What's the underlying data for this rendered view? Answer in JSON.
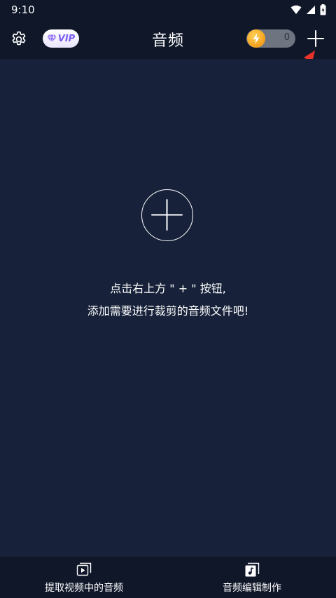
{
  "status_bar": {
    "time": "9:10",
    "icons": [
      "wifi-icon",
      "signal-icon",
      "battery-icon"
    ]
  },
  "header": {
    "title": "音频",
    "vip_label": "VIP",
    "energy_count": "0",
    "icons": [
      "gear-icon",
      "diamond-icon",
      "lightning-coin-icon",
      "plus-icon"
    ]
  },
  "main": {
    "hint_line_1": "点击右上方 \" + \" 按钮,",
    "hint_line_2": "添加需要进行裁剪的音频文件吧!"
  },
  "bottom_tabs": [
    {
      "label": "提取视频中的音频",
      "icon": "video-play-icon"
    },
    {
      "label": "音频编辑制作",
      "icon": "music-note-icon"
    }
  ],
  "colors": {
    "background": "#17223a",
    "header_background": "#0f1729",
    "annotation_arrow": "#e8322a",
    "coin": "#f5a623",
    "vip_text": "#7b5cf0"
  }
}
